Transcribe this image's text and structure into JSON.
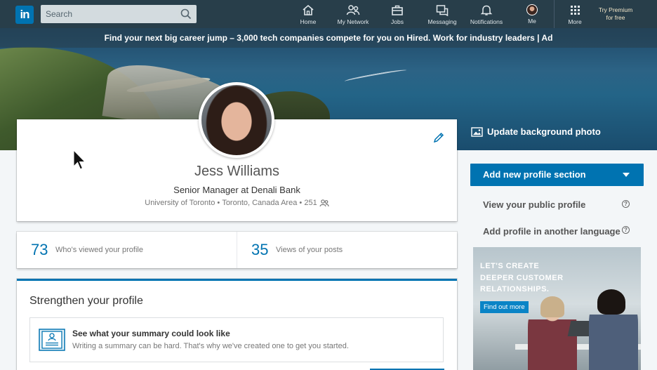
{
  "nav": {
    "logo": "in",
    "search_placeholder": "Search",
    "items": [
      {
        "label": "Home",
        "icon": "home-icon"
      },
      {
        "label": "My Network",
        "icon": "network-icon"
      },
      {
        "label": "Jobs",
        "icon": "briefcase-icon"
      },
      {
        "label": "Messaging",
        "icon": "messaging-icon"
      },
      {
        "label": "Notifications",
        "icon": "bell-icon"
      },
      {
        "label": "Me",
        "icon": "avatar"
      },
      {
        "label": "More",
        "icon": "grid-icon"
      }
    ],
    "premium_line1": "Try Premium",
    "premium_line2": "for free"
  },
  "ad_banner": "Find your next big career jump – 3,000 tech companies compete for you on Hired. Work for industry leaders | Ad",
  "profile": {
    "name": "Jess Williams",
    "headline": "Senior Manager at Denali Bank",
    "school": "University of Toronto",
    "location": "Toronto, Canada Area",
    "connections": "251"
  },
  "stats": {
    "profile_views": "73",
    "profile_views_label": "Who's viewed your profile",
    "post_views": "35",
    "post_views_label": "Views of your posts"
  },
  "strengthen": {
    "title": "Strengthen your profile",
    "summary_title": "See what your summary could look like",
    "summary_sub": "Writing a summary can be hard. That's why we've created one to get you started."
  },
  "rail": {
    "update_bg": "Update background photo",
    "add_section": "Add new profile section",
    "public_profile": "View your public profile",
    "other_language": "Add profile in another language"
  },
  "ad": {
    "line1": "LET'S CREATE",
    "line2": "DEEPER CUSTOMER",
    "line3": "RELATIONSHIPS.",
    "button": "Find out more"
  },
  "colors": {
    "nav_bg": "#283e4a",
    "brand_blue": "#0073b1",
    "page_bg": "#f3f6f8"
  }
}
